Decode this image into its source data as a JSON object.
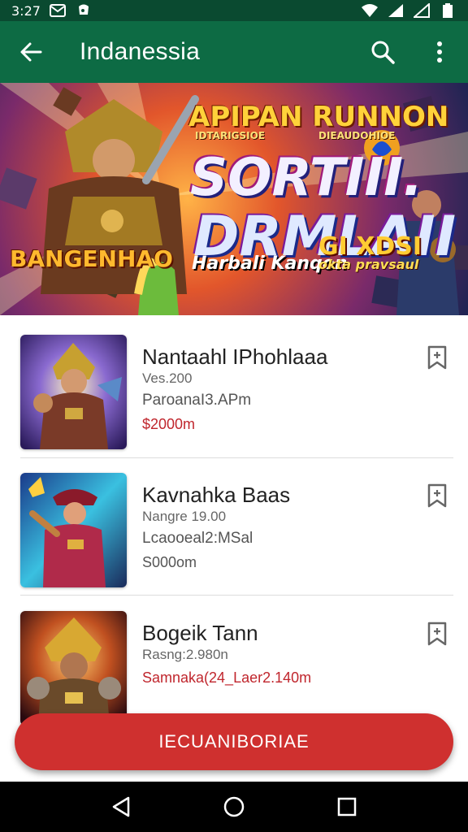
{
  "status_bar": {
    "time": "3:27",
    "icons": [
      "mail-icon",
      "notification-icon",
      "wifi-icon",
      "signal-icon",
      "signal-icon",
      "battery-icon"
    ]
  },
  "app_bar": {
    "title": "Indanessia",
    "back_icon": "arrow-left-icon",
    "search_icon": "search-icon",
    "menu_icon": "more-vert-icon",
    "color": "#0d6b44"
  },
  "banner": {
    "top_text": "APIPAN RUNNON",
    "sub_left": "IDTARIGSIOE",
    "sub_right": "DIEAUDOHIOE",
    "main_line1": "SORTIII.",
    "main_line2": "DRMLAII",
    "left_text": "BANGENHAO",
    "tagline": "Harbali Kanqon",
    "gi_text": "GI XDSI",
    "gi_sub": "okta pravsaul"
  },
  "items": [
    {
      "name": "Nantaahl IPhohlaaa",
      "line1": "Ves.200",
      "line2": "ParoanaI3.APm",
      "price": "$2000m",
      "price_color": "#c0262d"
    },
    {
      "name": "Kavnahka Baas",
      "line1": "Nangre 19.00",
      "line2": "Lcaooeal2:MSal",
      "price": "S000om",
      "price_color": "#555555"
    },
    {
      "name": "Bogeik Tann",
      "line1": "Rasng:2.980n",
      "price": "Samnaka(24_Laer2.140m",
      "price_color": "#c0262d"
    }
  ],
  "cta": {
    "label": "IECUANIBORIAE",
    "color": "#cf302f"
  },
  "nav": {
    "back": "triangle-back-icon",
    "home": "circle-home-icon",
    "recents": "square-recents-icon"
  }
}
